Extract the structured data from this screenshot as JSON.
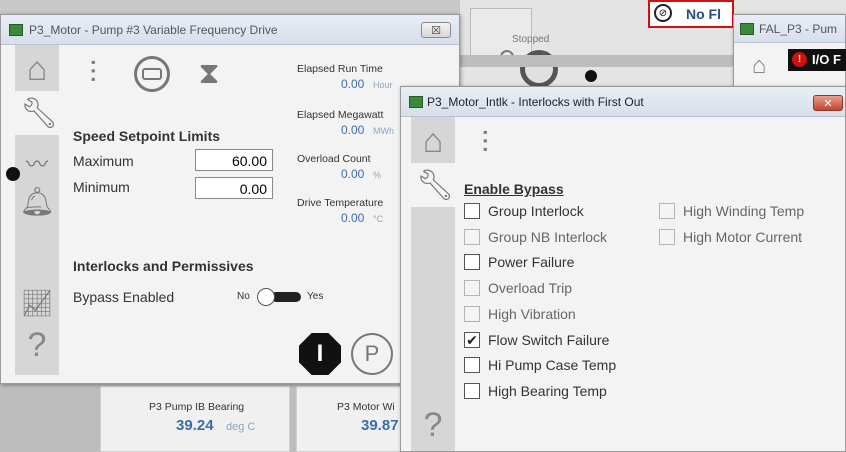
{
  "bg": {
    "stopped": "Stopped",
    "nofault": "No Fl",
    "fal_title": "FAL_P3 - Pum",
    "io": "I/O F"
  },
  "bottom": {
    "card1_label": "P3 Pump IB Bearing",
    "card1_value": "39.24",
    "card1_unit": "deg C",
    "card2_label": "P3 Motor Wi",
    "card2_value": "39.87"
  },
  "motor": {
    "title": "P3_Motor - Pump #3 Variable Frequency Drive",
    "close": "☒",
    "speed_header": "Speed Setpoint Limits",
    "max_label": "Maximum",
    "max_value": "60.00",
    "min_label": "Minimum",
    "min_value": "0.00",
    "runtime_label": "Elapsed Run Time",
    "runtime_value": "0.00",
    "runtime_unit": "Hour",
    "mw_label": "Elapsed Megawatt",
    "mw_value": "0.00",
    "mw_unit": "MWh",
    "overload_label": "Overload Count",
    "overload_value": "0.00",
    "overload_unit": "%",
    "temp_label": "Drive Temperature",
    "temp_value": "0.00",
    "temp_unit": "°C",
    "interlocks_header": "Interlocks and Permissives",
    "bypass_label": "Bypass Enabled",
    "no": "No",
    "yes": "Yes",
    "help": "?",
    "btn_i": "I",
    "btn_p": "P"
  },
  "intlk": {
    "title": "P3_Motor_Intlk - Interlocks with First Out",
    "close": "✕",
    "enable_bypass": "Enable Bypass",
    "help": "?",
    "left": [
      {
        "label": "Group Interlock",
        "checked": false,
        "enabled": true
      },
      {
        "label": "Group NB Interlock",
        "checked": false,
        "enabled": false
      },
      {
        "label": "Power Failure",
        "checked": false,
        "enabled": true
      },
      {
        "label": "Overload Trip",
        "checked": false,
        "enabled": false
      },
      {
        "label": "High Vibration",
        "checked": false,
        "enabled": false
      },
      {
        "label": "Flow Switch Failure",
        "checked": true,
        "enabled": true
      },
      {
        "label": "Hi Pump Case Temp",
        "checked": false,
        "enabled": true
      },
      {
        "label": "High Bearing Temp",
        "checked": false,
        "enabled": true
      }
    ],
    "right": [
      {
        "label": "High Winding Temp",
        "checked": false,
        "enabled": false
      },
      {
        "label": "High Motor Current",
        "checked": false,
        "enabled": false
      }
    ]
  },
  "colors": {
    "value_blue": "#3a6ea8",
    "alarm_red": "#cc1111"
  }
}
